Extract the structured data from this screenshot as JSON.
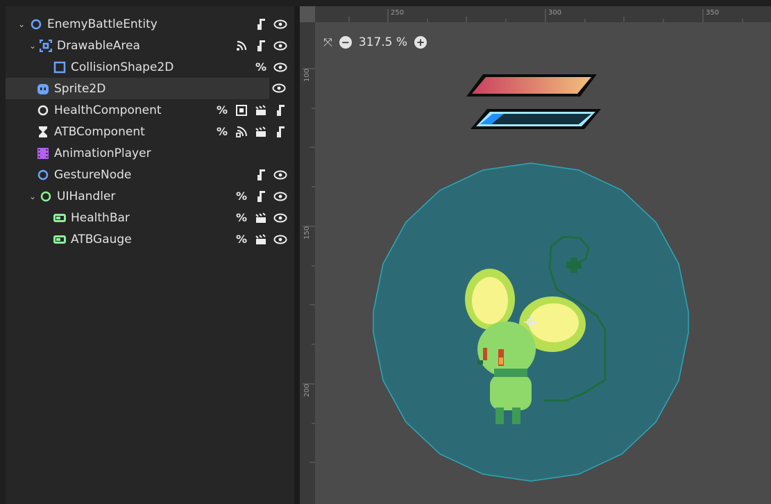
{
  "scene_tree": {
    "nodes": [
      {
        "label": "EnemyBattleEntity",
        "icon": "node2d-icon"
      },
      {
        "label": "DrawableArea",
        "icon": "area2d-icon"
      },
      {
        "label": "CollisionShape2D",
        "icon": "collision-shape-icon"
      },
      {
        "label": "Sprite2D",
        "icon": "sprite-icon"
      },
      {
        "label": "HealthComponent",
        "icon": "node-icon"
      },
      {
        "label": "ATBComponent",
        "icon": "timer-icon"
      },
      {
        "label": "AnimationPlayer",
        "icon": "animation-player-icon"
      },
      {
        "label": "GestureNode",
        "icon": "node2d-icon"
      },
      {
        "label": "UIHandler",
        "icon": "node2d-icon"
      },
      {
        "label": "HealthBar",
        "icon": "progress-bar-icon"
      },
      {
        "label": "ATBGauge",
        "icon": "progress-bar-icon"
      }
    ],
    "tool_glyph_percent": "%"
  },
  "viewport": {
    "zoom_level": "317.5 %",
    "ruler_top": [
      "250",
      "300",
      "350"
    ],
    "ruler_left": [
      "100",
      "150",
      "200"
    ],
    "health_bar_fill": 1.0,
    "atb_gauge_fill": 0.2
  },
  "colors": {
    "node2d_blue": "#6aa2ff",
    "control_green": "#8eef97",
    "collision_circle": "#2c6b76",
    "collision_outline": "#2fa6b8",
    "health_gradient": [
      "#c9415f",
      "#f2c07c"
    ],
    "atb_blue": "#1e90ff"
  }
}
